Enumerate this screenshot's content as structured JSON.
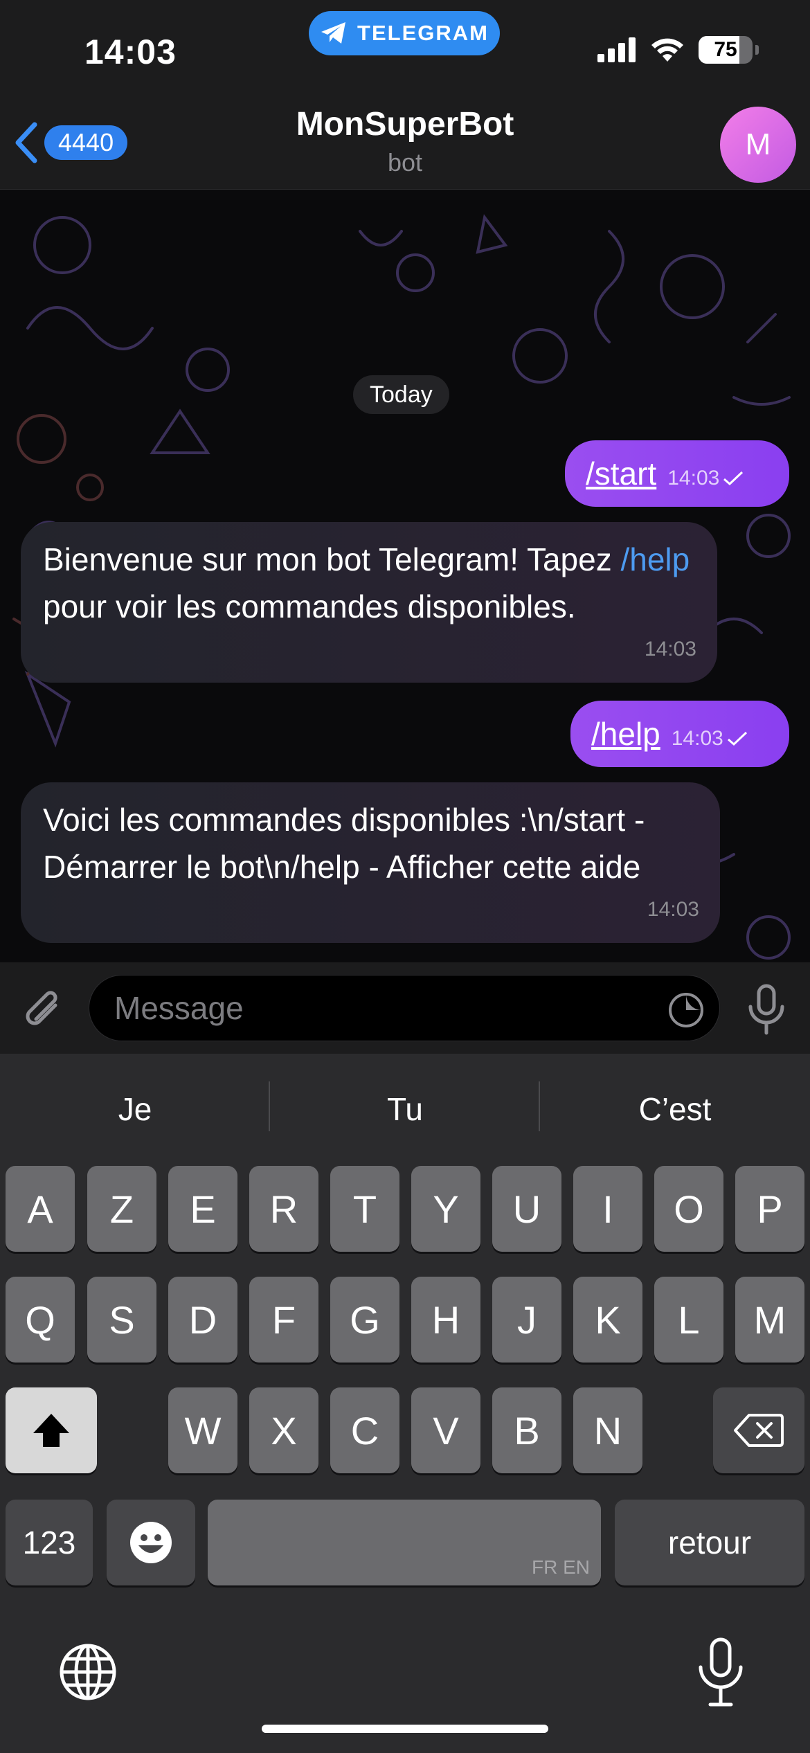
{
  "status_bar": {
    "time": "14:03",
    "app_pill": "TELEGRAM",
    "battery_percent": "75",
    "battery_level": 0.75
  },
  "header": {
    "back_count": "4440",
    "title": "MonSuperBot",
    "subtitle": "bot",
    "avatar_initial": "M"
  },
  "chat": {
    "date_label": "Today",
    "messages": [
      {
        "direction": "out",
        "text": "/start",
        "time": "14:03"
      },
      {
        "direction": "in",
        "text_before": "Bienvenue sur mon bot Telegram! Tapez ",
        "link": "/help",
        "text_after": " pour voir les commandes disponibles.",
        "time": "14:03"
      },
      {
        "direction": "out",
        "text": "/help",
        "time": "14:03"
      },
      {
        "direction": "in",
        "text": "Voici les commandes disponibles :\\n/start - Démarrer le bot\\n/help - Afficher cette aide",
        "time": "14:03"
      }
    ]
  },
  "input": {
    "placeholder": "Message"
  },
  "keyboard": {
    "suggestions": [
      "Je",
      "Tu",
      "C’est"
    ],
    "row1": [
      "A",
      "Z",
      "E",
      "R",
      "T",
      "Y",
      "U",
      "I",
      "O",
      "P"
    ],
    "row2": [
      "Q",
      "S",
      "D",
      "F",
      "G",
      "H",
      "J",
      "K",
      "L",
      "M"
    ],
    "row3": [
      "W",
      "X",
      "C",
      "V",
      "B",
      "N"
    ],
    "numbers_key": "123",
    "return_key": "retour",
    "space_lang": "FR EN"
  },
  "colors": {
    "accent_blue": "#2f8cf1",
    "outgoing_bubble": "#9a4ef0",
    "incoming_bubble": "#23242c",
    "link": "#4d9bf0"
  },
  "icons": [
    "telegram-plane-icon",
    "signal-icon",
    "wifi-icon",
    "battery-icon",
    "back-chevron-icon",
    "read-check-icon",
    "attach-icon",
    "sticker-icon",
    "microphone-icon",
    "shift-icon",
    "delete-icon",
    "emoji-icon",
    "globe-icon",
    "dictation-icon"
  ]
}
